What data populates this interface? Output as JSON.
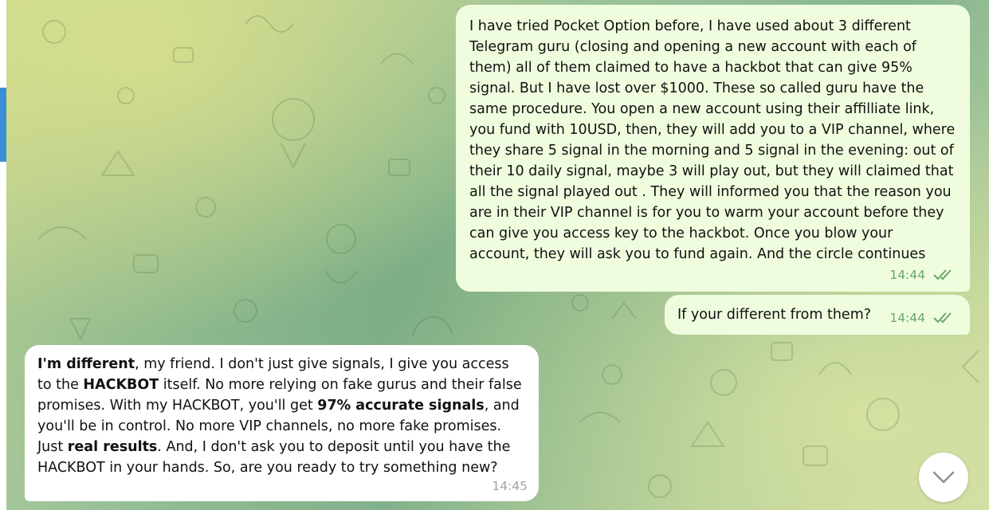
{
  "messages": [
    {
      "direction": "outgoing",
      "text": "I have tried  Pocket Option before, I have used about 3 different Telegram guru (closing and opening a new account with each of them) all of them claimed to have a hackbot that can give 95% signal. But I have lost over $1000. These so called guru have the same procedure. You open a new account using their affilliate link, you fund with 10USD, then, they will add you to a VIP channel, where they share 5 signal in the morning and 5 signal in the evening: out of their 10 daily signal, maybe 3 will play out, but they will claimed that all the signal played out . They will informed you that the reason you are in their VIP channel is for you to warm your account before they can give you access key to the hackbot. Once you blow your account, they will ask you to fund again. And the circle continues",
      "time": "14:44",
      "read": true
    },
    {
      "direction": "outgoing",
      "text": "If your different from them?",
      "time": "14:44",
      "read": true
    },
    {
      "direction": "incoming",
      "parts": [
        {
          "t": "I'm different",
          "bold": true
        },
        {
          "t": ", my friend. I don't just give signals, I give you access to the ",
          "bold": false
        },
        {
          "t": "HACKBOT",
          "bold": true
        },
        {
          "t": " itself. No more relying on fake gurus and their false promises. With my HACKBOT, you'll get ",
          "bold": false
        },
        {
          "t": "97% accurate signals",
          "bold": true
        },
        {
          "t": ", and you'll be in control. No more VIP channels, no more fake promises. Just ",
          "bold": false
        },
        {
          "t": "real results",
          "bold": true
        },
        {
          "t": ". And, I don't ask you to deposit until you have the HACKBOT in your hands. So, are you ready to try something new?",
          "bold": false
        }
      ],
      "time": "14:45"
    }
  ],
  "icons": {
    "read_receipt": "double-check-icon",
    "scroll_down": "chevron-down-icon"
  },
  "colors": {
    "outgoing_bubble": "#effdde",
    "incoming_bubble": "#ffffff",
    "outgoing_meta": "#6aa66a",
    "incoming_meta": "#a0a4a8",
    "sidebar_accent": "#3a8fd6"
  }
}
